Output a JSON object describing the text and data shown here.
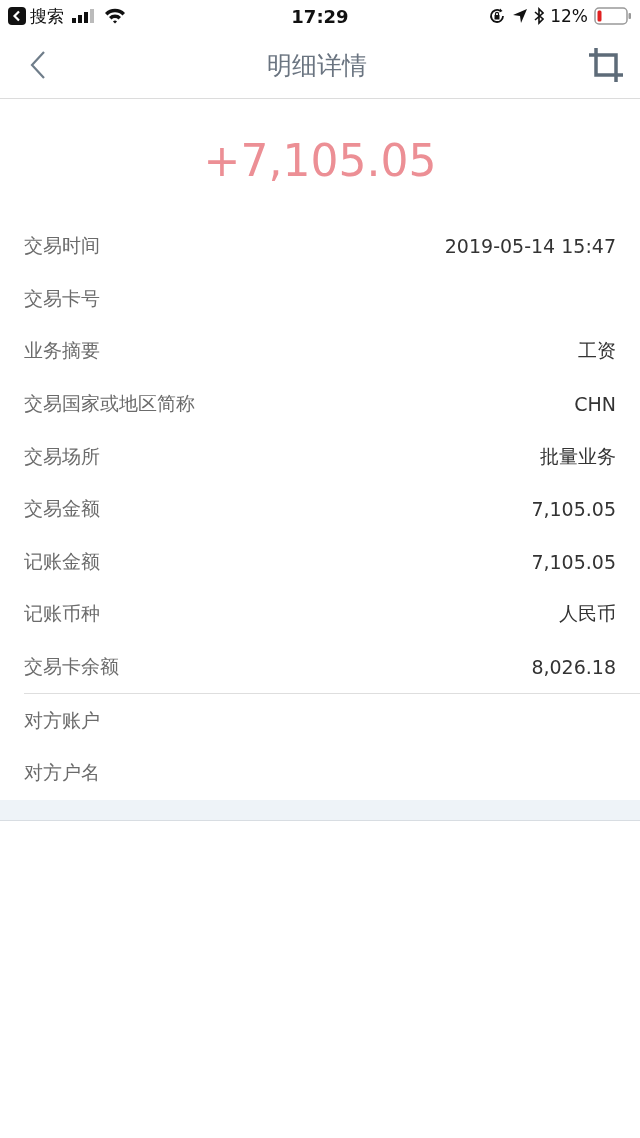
{
  "status_bar": {
    "back_app": "搜索",
    "time": "17:29",
    "battery": "12%"
  },
  "nav": {
    "title": "明细详情"
  },
  "amount": "+7,105.05",
  "sections": [
    [
      {
        "label": "交易时间",
        "value": "2019-05-14 15:47"
      },
      {
        "label": "交易卡号"
      },
      {
        "label": "业务摘要",
        "value": "工资"
      },
      {
        "label": "交易国家或地区简称",
        "value": "CHN"
      },
      {
        "label": "交易场所",
        "value": "批量业务"
      },
      {
        "label": "交易金额",
        "value": "7,105.05"
      },
      {
        "label": "记账金额",
        "value": "7,105.05"
      },
      {
        "label": "记账币种",
        "value": "人民币"
      },
      {
        "label": "交易卡余额",
        "value": "8,026.18"
      }
    ],
    [
      {
        "label": "对方账户"
      },
      {
        "label": "对方户名"
      }
    ]
  ]
}
